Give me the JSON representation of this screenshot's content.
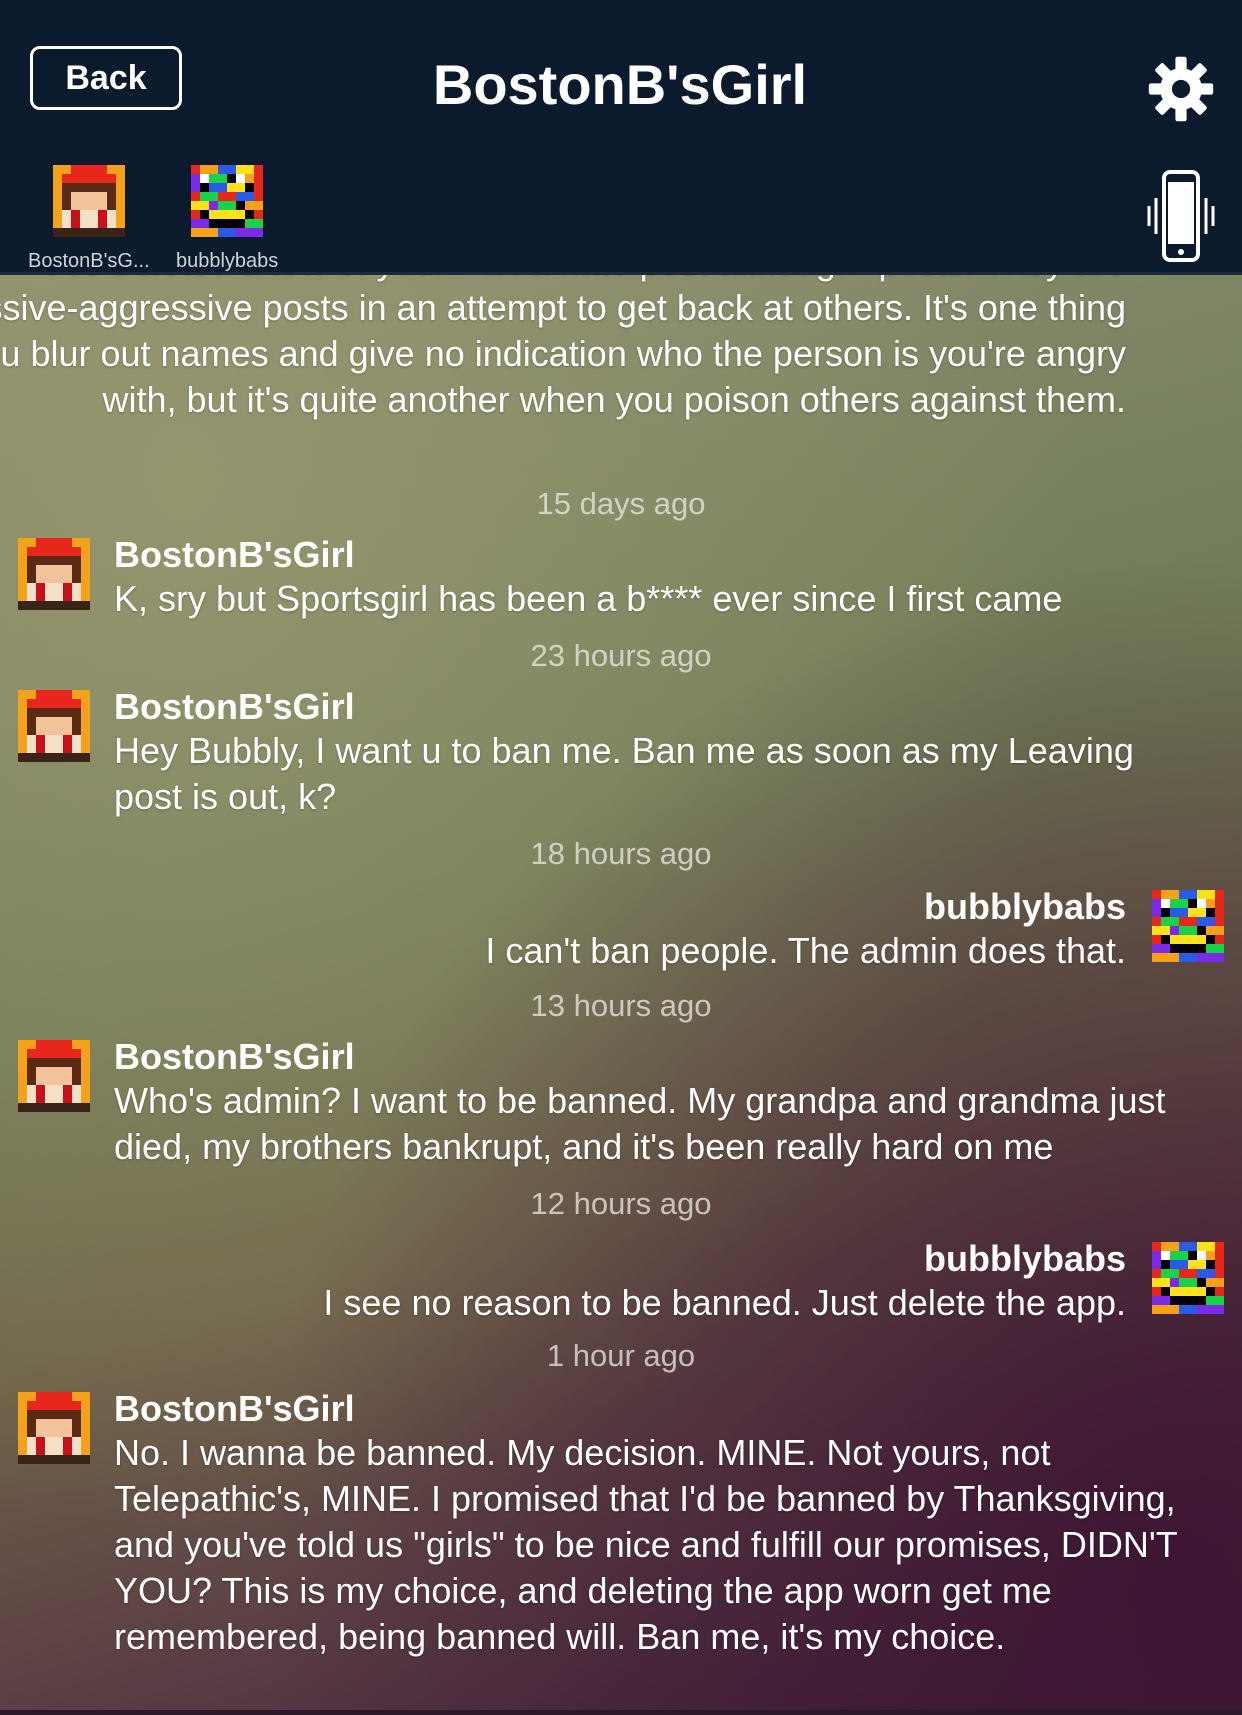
{
  "header": {
    "back_label": "Back",
    "title": "BostonB'sGirl",
    "settings_icon": "gear-icon",
    "vibrate_icon": "phone-vibrate-icon"
  },
  "participants": [
    {
      "name": "BostonB'sG...",
      "avatar": "pixel-girl-avatar"
    },
    {
      "name": "bubblybabs",
      "avatar": "rainbow-smiley-avatar"
    }
  ],
  "partial_message": {
    "text": "I've deleted a few of your \"not a hate post although\" posts. They are passive-aggressive posts in an attempt to get back at others. It's one thing if you blur out names and give no indication who the person is you're angry with, but it's quite another when you poison others against them."
  },
  "messages": [
    {
      "time": "15 days ago",
      "author": "BostonB'sGirl",
      "text": "K, sry but Sportsgirl has been a b**** ever since I first came",
      "side": "left"
    },
    {
      "time": "23 hours ago",
      "author": "BostonB'sGirl",
      "text": "Hey Bubbly, I want u to ban me. Ban me as soon as my Leaving post is out, k?",
      "side": "left"
    },
    {
      "time": "18 hours ago",
      "author": "bubblybabs",
      "text": "I can't ban people.  The admin does that.",
      "side": "right"
    },
    {
      "time": "13 hours ago",
      "author": "BostonB'sGirl",
      "text": "Who's admin? I want to be banned. My grandpa and grandma just died, my brothers bankrupt, and it's been really hard on me",
      "side": "left"
    },
    {
      "time": "12 hours ago",
      "author": "bubblybabs",
      "text": "I see no reason to be banned.  Just delete the app.",
      "side": "right"
    },
    {
      "time": "1 hour ago",
      "author": "BostonB'sGirl",
      "text": "No. I wanna be banned. My decision. MINE. Not yours, not Telepathic's, MINE. I promised that I'd be banned by Thanksgiving, and you've told us \"girls\" to be nice and fulfill our promises, DIDN'T YOU? This is my choice, and deleting the app worn get me remembered, being banned will. Ban me, it's my choice.",
      "side": "left"
    }
  ]
}
